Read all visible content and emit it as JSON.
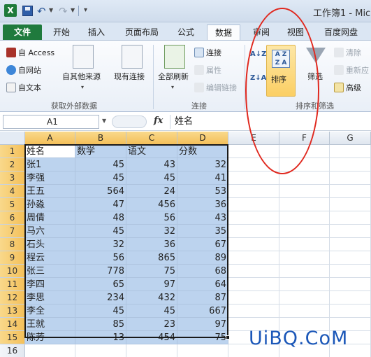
{
  "window": {
    "app_icon": "X",
    "title": "工作簿1 - Mic"
  },
  "tabs": [
    {
      "label": "文件"
    },
    {
      "label": "开始"
    },
    {
      "label": "插入"
    },
    {
      "label": "页面布局"
    },
    {
      "label": "公式"
    },
    {
      "label": "数据"
    },
    {
      "label": "审阅"
    },
    {
      "label": "视图"
    },
    {
      "label": "百度网盘"
    }
  ],
  "ribbon": {
    "external": {
      "access": "自 Access",
      "web": "自网站",
      "text": "自文本",
      "other": "自其他来源",
      "existing": "现有连接",
      "group_label": "获取外部数据"
    },
    "connections": {
      "refresh_all": "全部刷新",
      "connections": "连接",
      "properties": "属性",
      "edit_links": "编辑链接",
      "group_label": "连接"
    },
    "sort_filter": {
      "sort_az": "A↓Z",
      "sort": "排序",
      "filter": "筛选",
      "clear": "清除",
      "reapply": "重新应",
      "advanced": "高级",
      "group_label": "排序和筛选"
    }
  },
  "formula_bar": {
    "name_box": "A1",
    "fx": "fx",
    "formula": "姓名"
  },
  "columns": [
    "A",
    "B",
    "C",
    "D",
    "E",
    "F",
    "G"
  ],
  "rows": [
    {
      "num": "1",
      "cells": [
        "姓名",
        "数学",
        "语文",
        "分数"
      ]
    },
    {
      "num": "2",
      "cells": [
        "张1",
        "45",
        "43",
        "32"
      ]
    },
    {
      "num": "3",
      "cells": [
        "李强",
        "45",
        "45",
        "41"
      ]
    },
    {
      "num": "4",
      "cells": [
        "王五",
        "564",
        "24",
        "53"
      ]
    },
    {
      "num": "5",
      "cells": [
        "孙淼",
        "47",
        "456",
        "36"
      ]
    },
    {
      "num": "6",
      "cells": [
        "周倩",
        "48",
        "56",
        "43"
      ]
    },
    {
      "num": "7",
      "cells": [
        "马六",
        "45",
        "32",
        "35"
      ]
    },
    {
      "num": "8",
      "cells": [
        "石头",
        "32",
        "36",
        "67"
      ]
    },
    {
      "num": "9",
      "cells": [
        "程云",
        "56",
        "865",
        "89"
      ]
    },
    {
      "num": "10",
      "cells": [
        "张三",
        "778",
        "75",
        "68"
      ]
    },
    {
      "num": "11",
      "cells": [
        "李四",
        "65",
        "97",
        "64"
      ]
    },
    {
      "num": "12",
      "cells": [
        "李思",
        "234",
        "432",
        "87"
      ]
    },
    {
      "num": "13",
      "cells": [
        "李全",
        "45",
        "45",
        "667"
      ]
    },
    {
      "num": "14",
      "cells": [
        "王就",
        "85",
        "23",
        "97"
      ]
    },
    {
      "num": "15",
      "cells": [
        "陈芳",
        "13",
        "454",
        "75"
      ]
    },
    {
      "num": "16",
      "cells": [
        "",
        "",
        "",
        ""
      ]
    }
  ],
  "watermark": "UiBQ.CoM",
  "colors": {
    "selection": "#bcd3ee",
    "header_selected": "#f4c05a",
    "file_tab": "#1f7a3d",
    "annotation": "#e0281e"
  }
}
